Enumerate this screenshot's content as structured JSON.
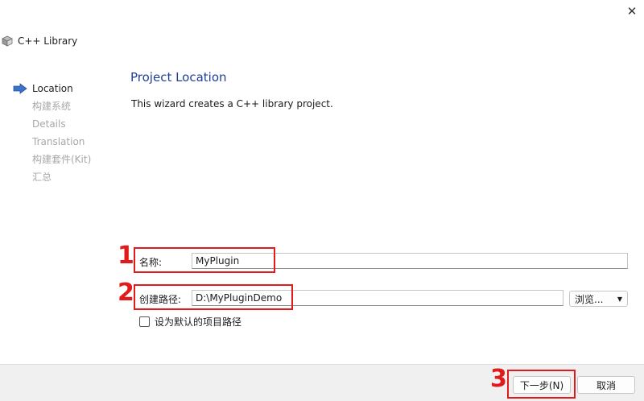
{
  "window": {
    "close_glyph": "✕"
  },
  "header": {
    "title": "C++ Library",
    "icon": "cube-icon"
  },
  "steps": [
    {
      "label": "Location",
      "active": true
    },
    {
      "label": "构建系统",
      "active": false
    },
    {
      "label": "Details",
      "active": false
    },
    {
      "label": "Translation",
      "active": false
    },
    {
      "label": "构建套件(Kit)",
      "active": false
    },
    {
      "label": "汇总",
      "active": false
    }
  ],
  "page": {
    "heading": "Project Location",
    "description": "This wizard creates a C++ library project."
  },
  "form": {
    "name_label": "名称:",
    "name_value": "MyPlugin",
    "path_label": "创建路径:",
    "path_value": "D:\\MyPluginDemo",
    "browse_label": "浏览...",
    "default_path_label": "设为默认的项目路径",
    "default_path_checked": false
  },
  "annotations": [
    "1",
    "2",
    "3"
  ],
  "footer": {
    "next_label": "下一步(N)",
    "cancel_label": "取消"
  },
  "colors": {
    "accent_heading": "#1e3f9a",
    "annotation_red": "#e21a1a"
  }
}
